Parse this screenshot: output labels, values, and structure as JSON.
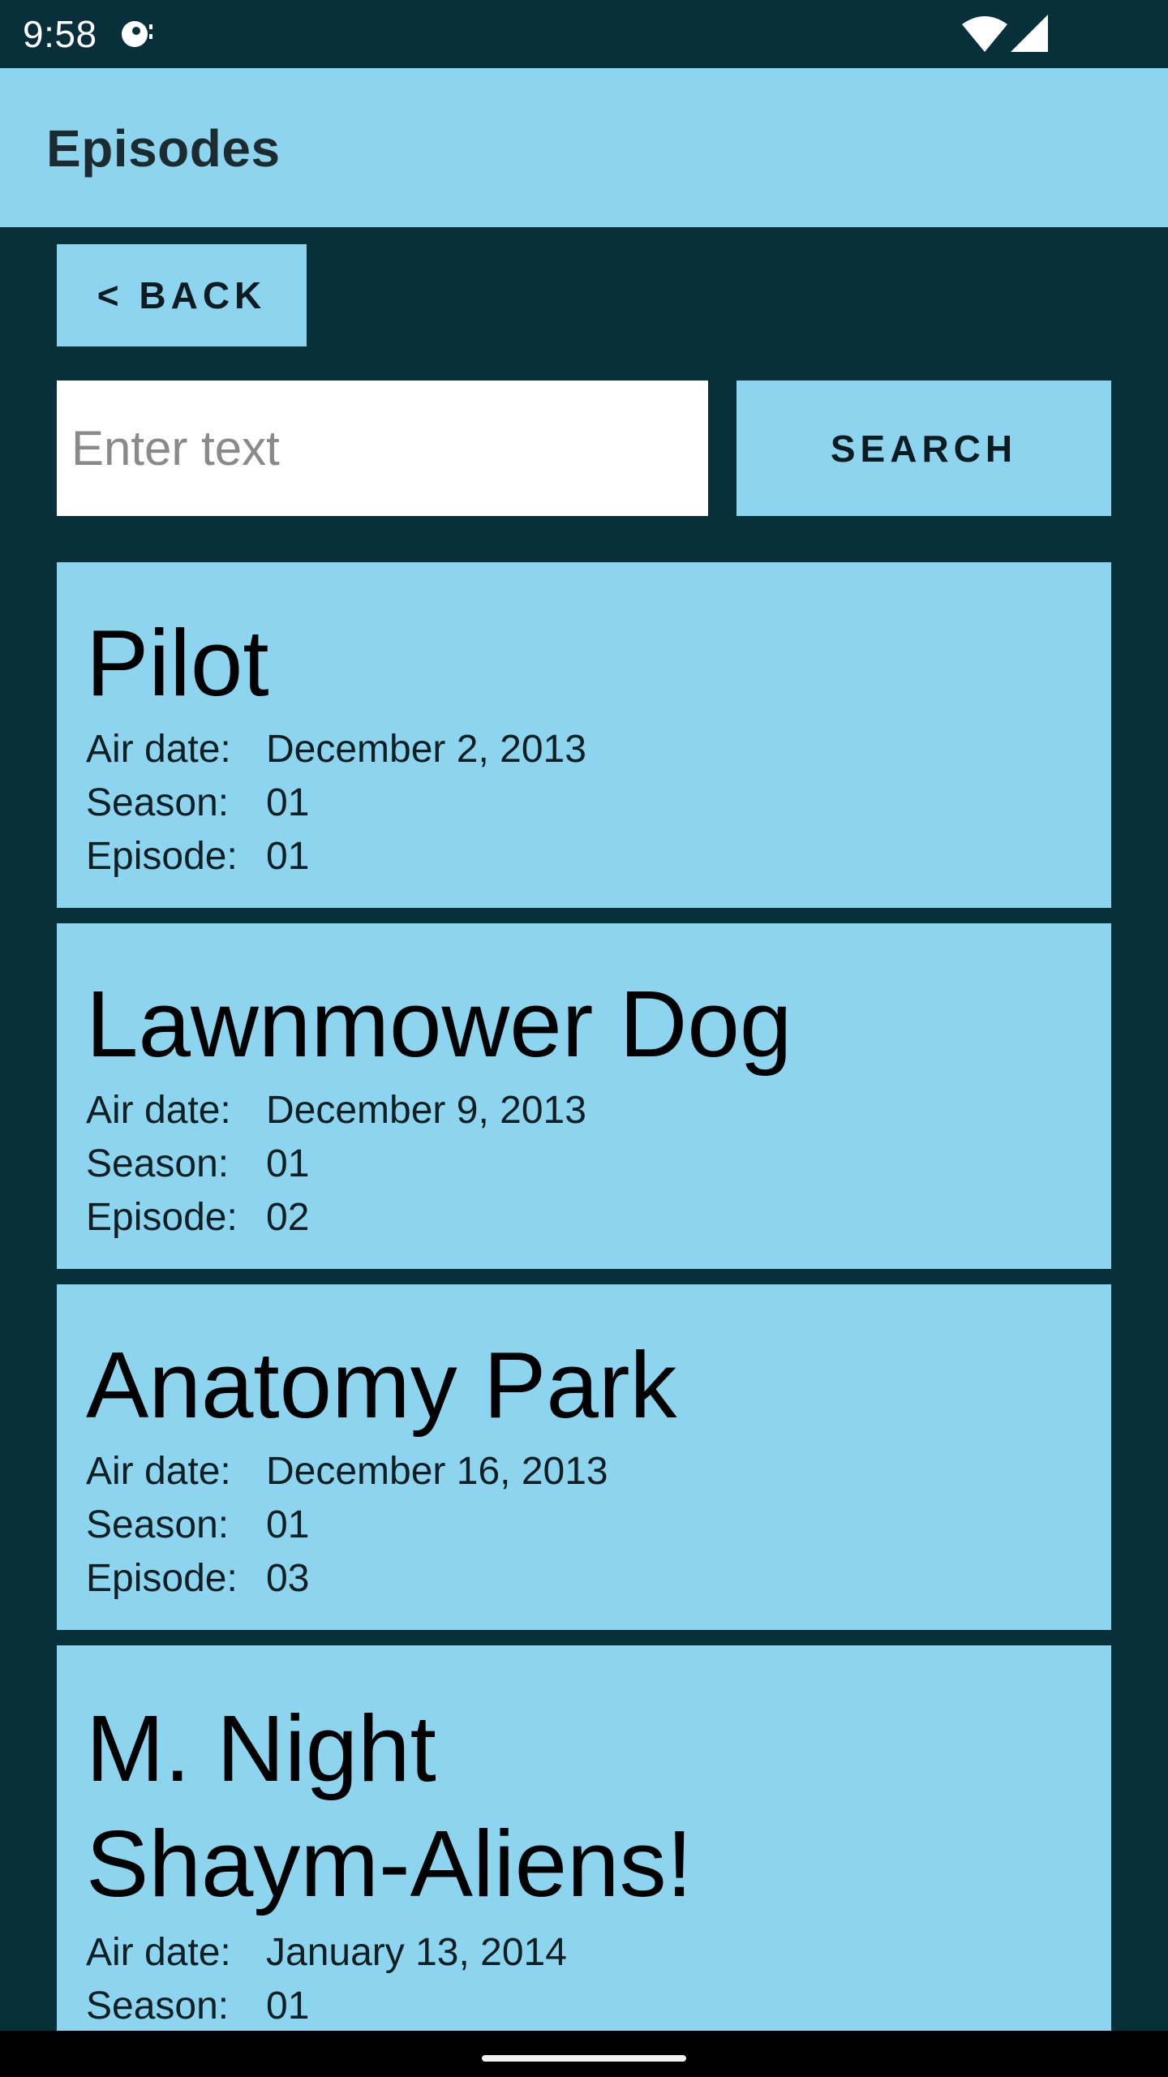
{
  "status_bar": {
    "time": "9:58",
    "icons": [
      "media-icon",
      "wifi-icon",
      "cell-signal-icon"
    ]
  },
  "app_bar": {
    "title": "Episodes"
  },
  "controls": {
    "back_label": "< BACK",
    "search_placeholder": "Enter text",
    "search_value": "",
    "search_label": "SEARCH"
  },
  "labels": {
    "air_date": "Air date:",
    "season": "Season:",
    "episode": "Episode:"
  },
  "episodes": [
    {
      "title": "Pilot",
      "air_date": "December 2, 2013",
      "season": "01",
      "episode": "01"
    },
    {
      "title": "Lawnmower Dog",
      "air_date": "December 9, 2013",
      "season": "01",
      "episode": "02"
    },
    {
      "title": "Anatomy Park",
      "air_date": "December 16, 2013",
      "season": "01",
      "episode": "03"
    },
    {
      "title_line1": "M. Night",
      "title_line2": "Shaym-Aliens!",
      "air_date": "January 13, 2014",
      "season": "01"
    }
  ],
  "colors": {
    "background": "#07303a",
    "accent": "#8dd5ee",
    "text": "#000000"
  }
}
